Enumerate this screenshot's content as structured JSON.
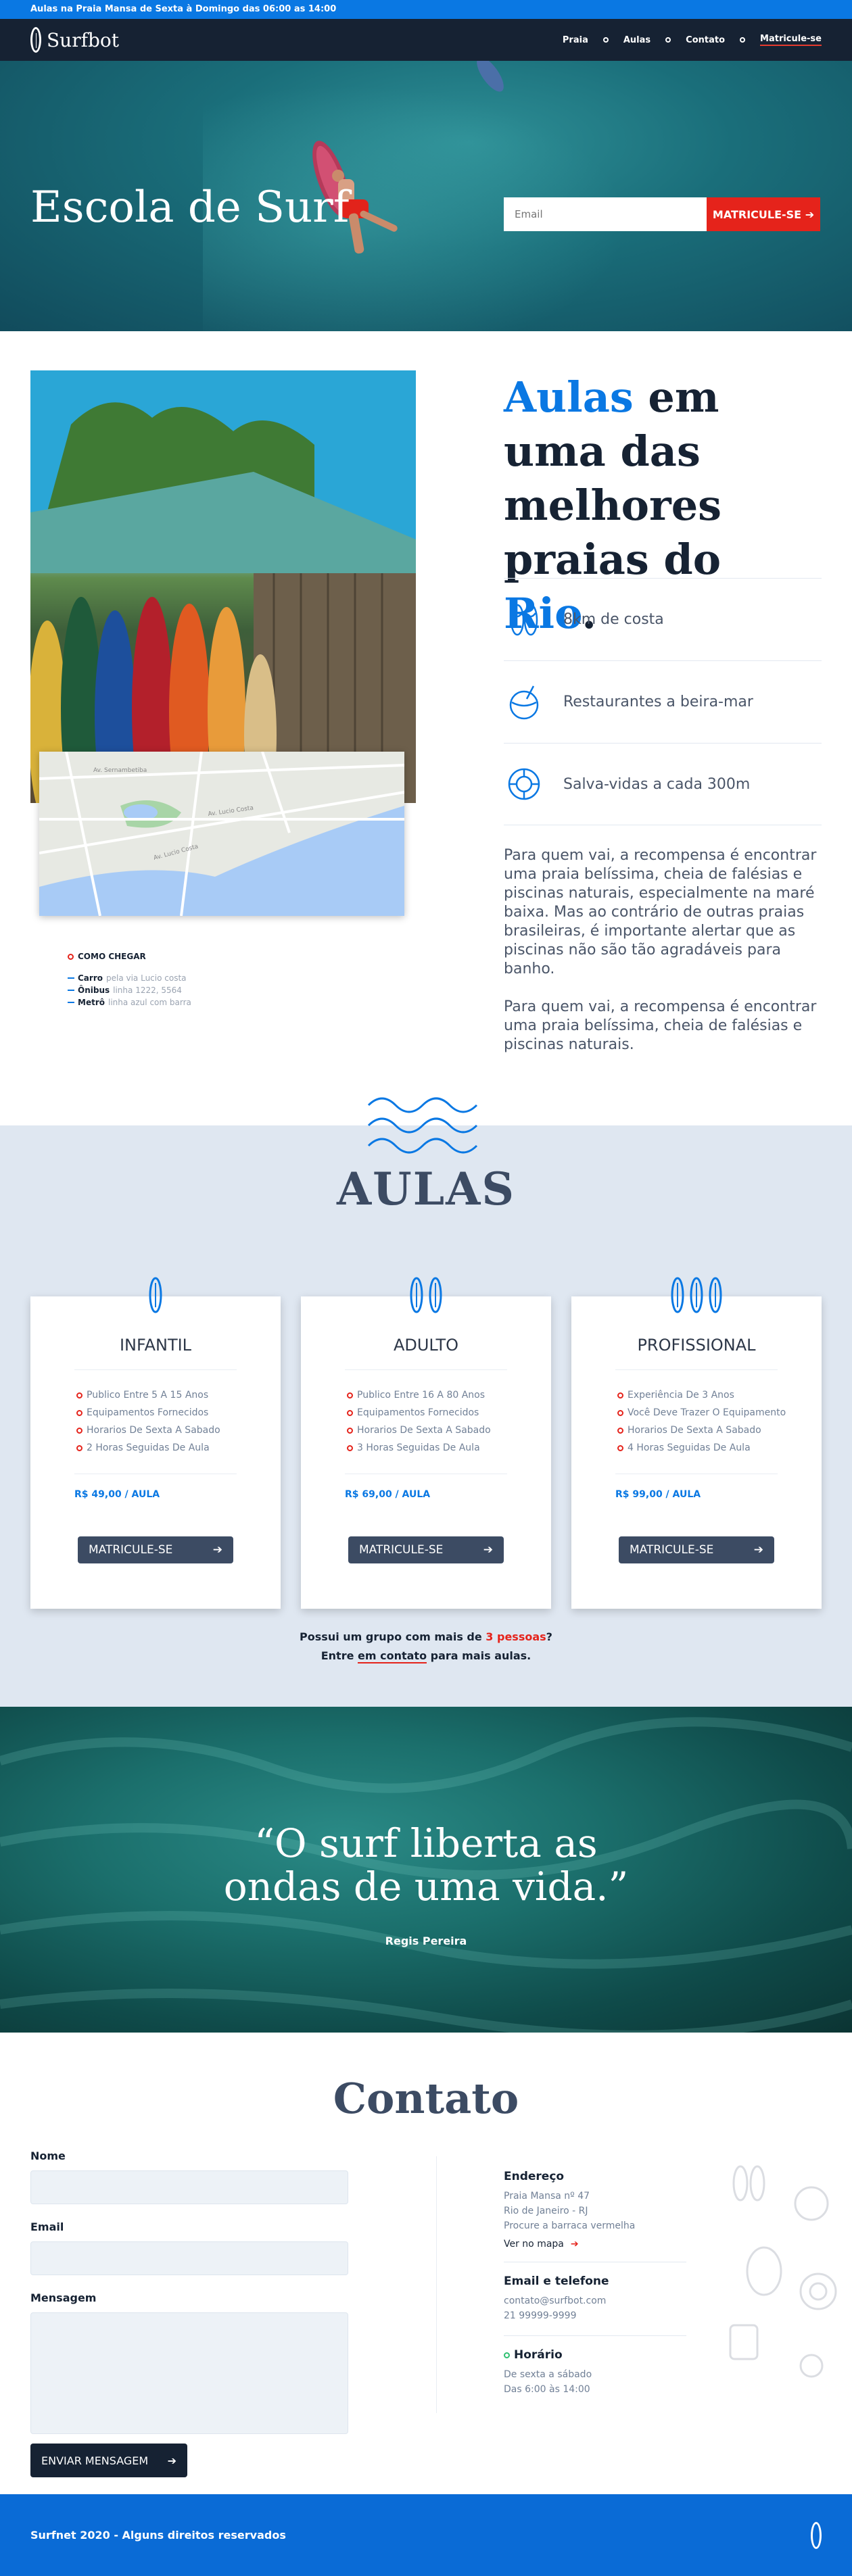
{
  "topbar": {
    "text": "Aulas na Praia Mansa de Sexta à Domingo das 06:00 as 14:00"
  },
  "nav": {
    "logo": "Surfbot",
    "items": [
      "Praia",
      "Aulas",
      "Contato",
      "Matricule-se"
    ]
  },
  "hero": {
    "title": "Escola de Surf",
    "email_placeholder": "Email",
    "cta": "MATRICULE-SE"
  },
  "about": {
    "title_parts": [
      "Aulas",
      " em uma das melhores praias do ",
      "Rio",
      "."
    ],
    "features": [
      {
        "icon": "flip-flops-icon",
        "label": "8km de costa"
      },
      {
        "icon": "coconut-drink-icon",
        "label": "Restaurantes a beira-mar"
      },
      {
        "icon": "lifebuoy-icon",
        "label": "Salva-vidas a cada 300m"
      }
    ],
    "paragraphs": [
      "Para quem vai, a recompensa é encontrar uma praia belíssima, cheia de falésias e piscinas naturais, especialmente na maré baixa. Mas ao contrário de outras praias brasileiras, é importante alertar que as piscinas não são tão agradáveis para banho.",
      "Para quem vai, a recompensa é encontrar uma praia belíssima, cheia de falésias e piscinas naturais."
    ],
    "how": {
      "heading": "COMO CHEGAR",
      "rows": [
        {
          "mode": "Carro",
          "detail": "pela via Lucio costa"
        },
        {
          "mode": "Ônibus",
          "detail": "linha 1222, 5564"
        },
        {
          "mode": "Metrô",
          "detail": "linha azul com barra"
        }
      ]
    },
    "map_labels": [
      "Av. Lucio Costa",
      "Av. Lucio Costa",
      "Av. Sernambetiba"
    ]
  },
  "aulas": {
    "title": "AULAS",
    "cards": [
      {
        "name": "INFANTIL",
        "boards": 1,
        "items": [
          "Publico Entre 5 A 15 Anos",
          "Equipamentos Fornecidos",
          "Horarios De Sexta A Sabado",
          "2 Horas Seguidas De Aula"
        ],
        "price": "R$ 49,00 / AULA",
        "button": "MATRICULE-SE"
      },
      {
        "name": "ADULTO",
        "boards": 2,
        "items": [
          "Publico Entre 16 A 80 Anos",
          "Equipamentos Fornecidos",
          "Horarios De Sexta A Sabado",
          "3 Horas Seguidas De Aula"
        ],
        "price": "R$ 69,00 / AULA",
        "button": "MATRICULE-SE"
      },
      {
        "name": "PROFISSIONAL",
        "boards": 3,
        "items": [
          "Experiência De 3 Anos",
          "Você Deve Trazer O Equipamento",
          "Horarios De Sexta A Sabado",
          "4 Horas Seguidas De Aula"
        ],
        "price": "R$ 99,00 / AULA",
        "button": "MATRICULE-SE"
      }
    ],
    "group_line1_pre": "Possui um grupo com mais de ",
    "group_highlight": "3 pessoas",
    "group_line1_post": "?",
    "group_line2_pre": "Entre ",
    "group_link": "em contato",
    "group_line2_post": " para mais aulas."
  },
  "quote": {
    "text_line1": "“O surf liberta as",
    "text_line2": "ondas de uma vida.”",
    "author": "Regis Pereira"
  },
  "contato": {
    "title": "Contato",
    "fields": {
      "nome": "Nome",
      "email": "Email",
      "mensagem": "Mensagem"
    },
    "send": "ENVIAR MENSAGEM",
    "endereco": {
      "heading": "Endereço",
      "lines": [
        "Praia Mansa nº 47",
        "Rio de Janeiro - RJ",
        "Procure a barraca vermelha"
      ],
      "link": "Ver no mapa"
    },
    "telefone": {
      "heading": "Email e telefone",
      "lines": [
        "contato@surfbot.com",
        "21 99999-9999"
      ]
    },
    "horario": {
      "heading": "Horário",
      "lines": [
        "De sexta a sábado",
        "Das 6:00 às 14:00"
      ]
    }
  },
  "footer": {
    "text": "Surfnet 2020 - Alguns direitos reservados"
  },
  "colors": {
    "primary": "#0a78e3",
    "accent": "#e5231b",
    "dark": "#162233",
    "slate": "#3c4b63"
  }
}
